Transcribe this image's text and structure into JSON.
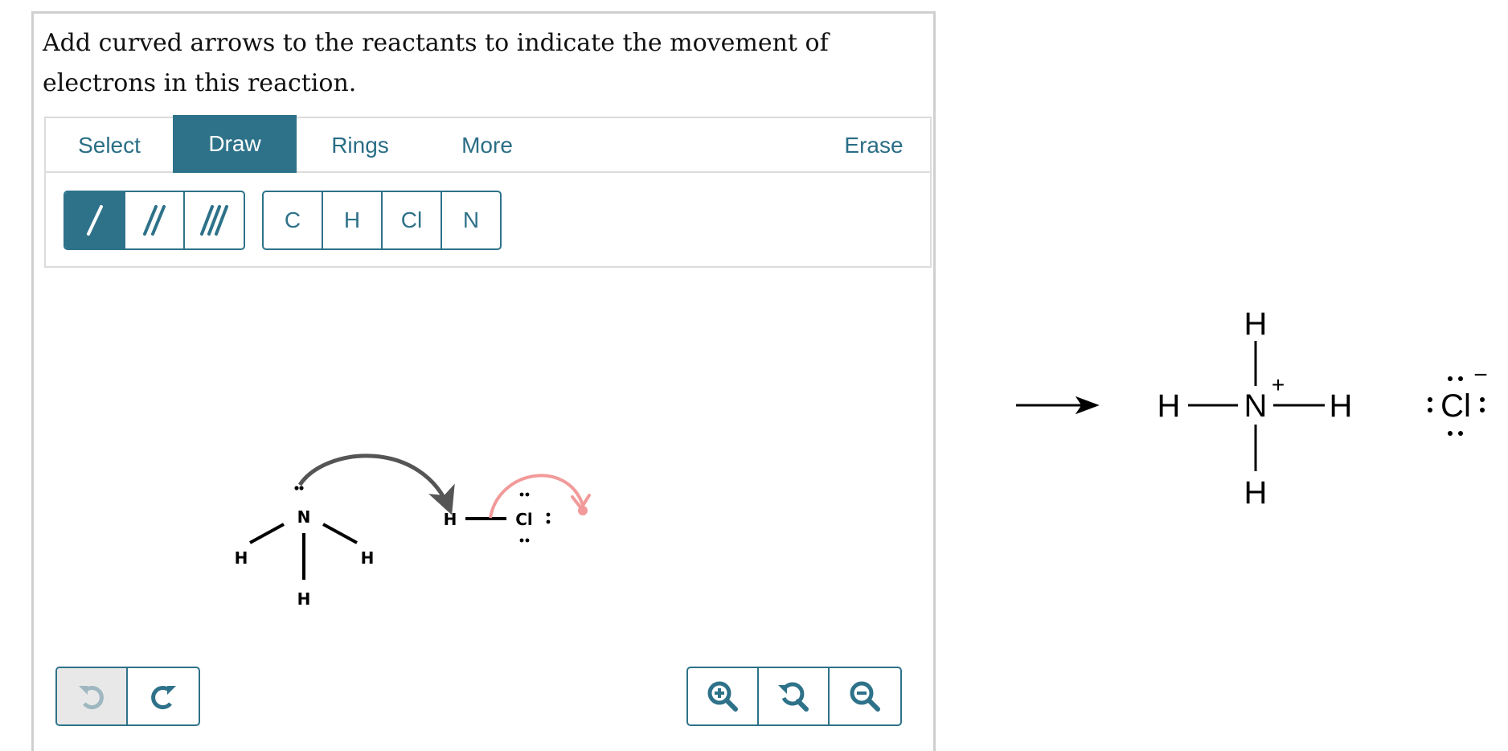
{
  "prompt": "Add curved arrows to the reactants to indicate the movement of electrons in this reaction.",
  "tabs": [
    {
      "label": "Select",
      "active": false
    },
    {
      "label": "Draw",
      "active": true
    },
    {
      "label": "Rings",
      "active": false
    },
    {
      "label": "More",
      "active": false
    },
    {
      "label": "Erase",
      "active": false
    }
  ],
  "bond_tools": [
    {
      "name": "single-bond",
      "active": true
    },
    {
      "name": "double-bond",
      "active": false
    },
    {
      "name": "triple-bond",
      "active": false
    }
  ],
  "atom_tools": [
    "C",
    "H",
    "Cl",
    "N"
  ],
  "reactants": {
    "ammonia": {
      "center": "N",
      "h1": "H",
      "h2": "H",
      "h3": "H"
    },
    "hcl": {
      "h": "H",
      "cl": "Cl"
    }
  },
  "history_buttons": [
    {
      "icon": "undo-icon",
      "disabled": true
    },
    {
      "icon": "redo-icon",
      "disabled": false
    }
  ],
  "zoom_buttons": [
    {
      "icon": "zoom-in-icon"
    },
    {
      "icon": "zoom-reset-icon"
    },
    {
      "icon": "zoom-out-icon"
    }
  ],
  "product": {
    "center": "N",
    "charge_plus": "+",
    "h_top": "H",
    "h_left": "H",
    "h_right": "H",
    "h_bottom": "H",
    "anion": "Cl",
    "charge_minus": "−"
  },
  "colors": {
    "accent": "#2e7289",
    "arrow_dark": "#555555",
    "arrow_pink": "#f29a9a"
  }
}
